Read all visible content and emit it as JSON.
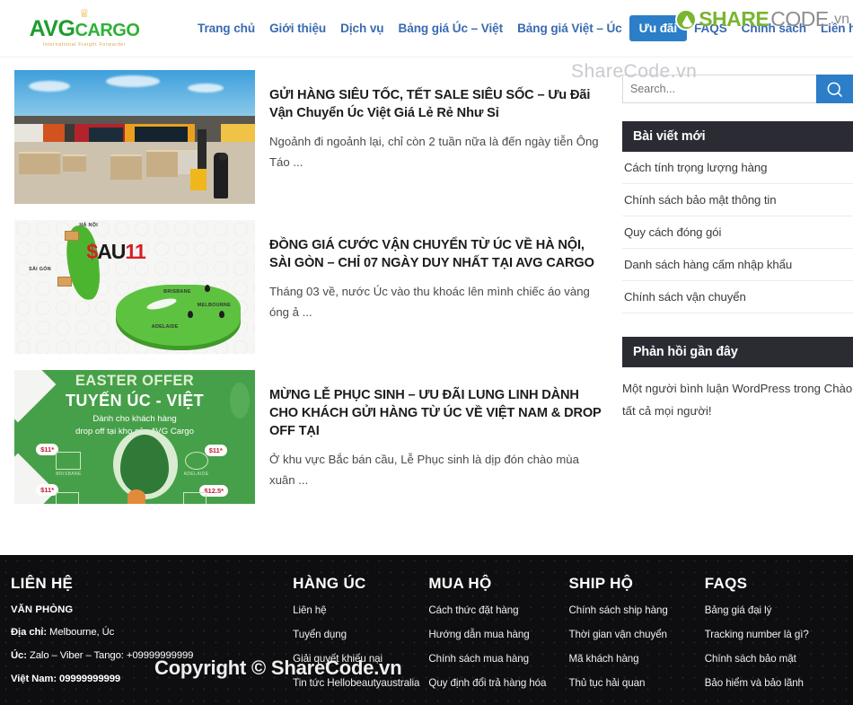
{
  "site": {
    "logo": {
      "crown": "♕",
      "part1": "AVG",
      "part2": "CARGO",
      "tagline": "International Freight Forwarder"
    }
  },
  "nav": {
    "items": [
      {
        "label": "Trang chủ",
        "active": false
      },
      {
        "label": "Giới thiệu",
        "active": false
      },
      {
        "label": "Dịch vụ",
        "active": false
      },
      {
        "label": "Bảng giá Úc – Việt",
        "active": false
      },
      {
        "label": "Bảng giá Việt – Úc",
        "active": false
      },
      {
        "label": "Ưu đãi",
        "active": true
      },
      {
        "label": "FAQS",
        "active": false
      },
      {
        "label": "Chính sách",
        "active": false
      },
      {
        "label": "Liên hệ",
        "active": false
      }
    ]
  },
  "brand_overlay": {
    "share": "SHARE",
    "code": "CODE",
    "vn": ".vn",
    "icon": "sharecode-logo-icon"
  },
  "watermarks": {
    "sidebar": "ShareCode.vn",
    "footer": "Copyright © ShareCode.vn"
  },
  "posts": [
    {
      "title": "GỬI HÀNG SIÊU TỐC, TẾT SALE SIÊU SỐC – Ưu Đãi Vận Chuyển Úc Việt Giá Lẻ Rẻ Như Sỉ",
      "excerpt": "Ngoảnh đi ngoảnh lại, chỉ còn 2 tuần nữa là đến ngày tiễn Ông Táo ...",
      "image": "warehouse-pallets-forklift-photo"
    },
    {
      "title": "ĐỒNG GIÁ CƯỚC VẬN CHUYỂN TỪ ÚC VỀ HÀ NỘI, SÀI GÒN – CHỈ 07 NGÀY DUY NHẤT TẠI AVG CARGO",
      "excerpt": "Tháng 03 về, nước Úc vào thu khoác lên mình chiếc áo vàng óng ả ...",
      "image": "vietnam-australia-map-graphic"
    },
    {
      "title": "MỪNG LỄ PHỤC SINH – ƯU ĐÃI LUNG LINH DÀNH CHO KHÁCH GỬI HÀNG TỪ ÚC VỀ VIỆT NAM & DROP OFF TẠI",
      "excerpt": "Ở khu vực Bắc bán cầu, Lễ Phục sinh là dịp đón chào mùa xuân ...",
      "image": "easter-offer-banner"
    }
  ],
  "post_image_2": {
    "price": {
      "currency": "$",
      "letters": "AU",
      "number": "11"
    },
    "labels": [
      "HÀ NỘI",
      "SÀI GÒN",
      "BRISBANE",
      "MELBOURNE",
      "ADELAIDE"
    ]
  },
  "post_image_3": {
    "line1": "EASTER OFFER",
    "line2": "TUYẾN ÚC - VIỆT",
    "line3": "Dành cho khách hàng",
    "line4": "drop off tại kho của AVG Cargo",
    "bubbles": [
      "$11*",
      "$11*",
      "$11*",
      "$12.5*"
    ],
    "cities": [
      "BRISBANE",
      "ADELAIDE"
    ]
  },
  "search": {
    "placeholder": "Search...",
    "value": "",
    "icon": "search-icon"
  },
  "widgets": {
    "recent_posts": {
      "title": "Bài viết mới",
      "items": [
        "Cách tính trọng lượng hàng",
        "Chính sách bảo mật thông tin",
        "Quy cách đóng gói",
        "Danh sách hàng cấm nhập khẩu",
        "Chính sách vận chuyển"
      ]
    },
    "recent_comments": {
      "title": "Phản hồi gần đây",
      "text": "Một người bình luận WordPress trong Chào tất cả mọi người!"
    }
  },
  "footer": {
    "columns": [
      {
        "heading": "LIÊN HỆ",
        "subhead": "VĂN PHÒNG",
        "lines": [
          {
            "label": "Địa chỉ:",
            "value": " Melbourne, Úc"
          },
          {
            "label": "Úc:",
            "value": " Zalo – Viber – Tango: +09999999999"
          },
          {
            "label": "Việt Nam:",
            "value": " 09999999999"
          }
        ]
      },
      {
        "heading": "HÀNG ÚC",
        "links": [
          "Liên hệ",
          "Tuyển dụng",
          "Giải quyết khiếu nại",
          "Tin tức Hellobeautyaustralia"
        ]
      },
      {
        "heading": "MUA HỘ",
        "links": [
          "Cách thức đặt hàng",
          "Hướng dẫn mua hàng",
          "Chính sách mua hàng",
          "Quy định đổi trả hàng hóa"
        ]
      },
      {
        "heading": "SHIP HỘ",
        "links": [
          "Chính sách ship hàng",
          "Thời gian vận chuyển",
          "Mã khách hàng",
          "Thủ tục hải quan"
        ]
      },
      {
        "heading": "FAQS",
        "links": [
          "Bảng giá đại lý",
          "Tracking number là gì?",
          "Chính sách bảo mật",
          "Bảo hiểm và bảo lãnh"
        ]
      }
    ]
  },
  "colors": {
    "nav_blue": "#3a6bb0",
    "accent_blue": "#2b7ec7",
    "brand_green": "#1f9c2e",
    "widget_dark": "#2b2b33",
    "footer_bg": "#0e0e10",
    "sharecode_green": "#7ab530"
  }
}
